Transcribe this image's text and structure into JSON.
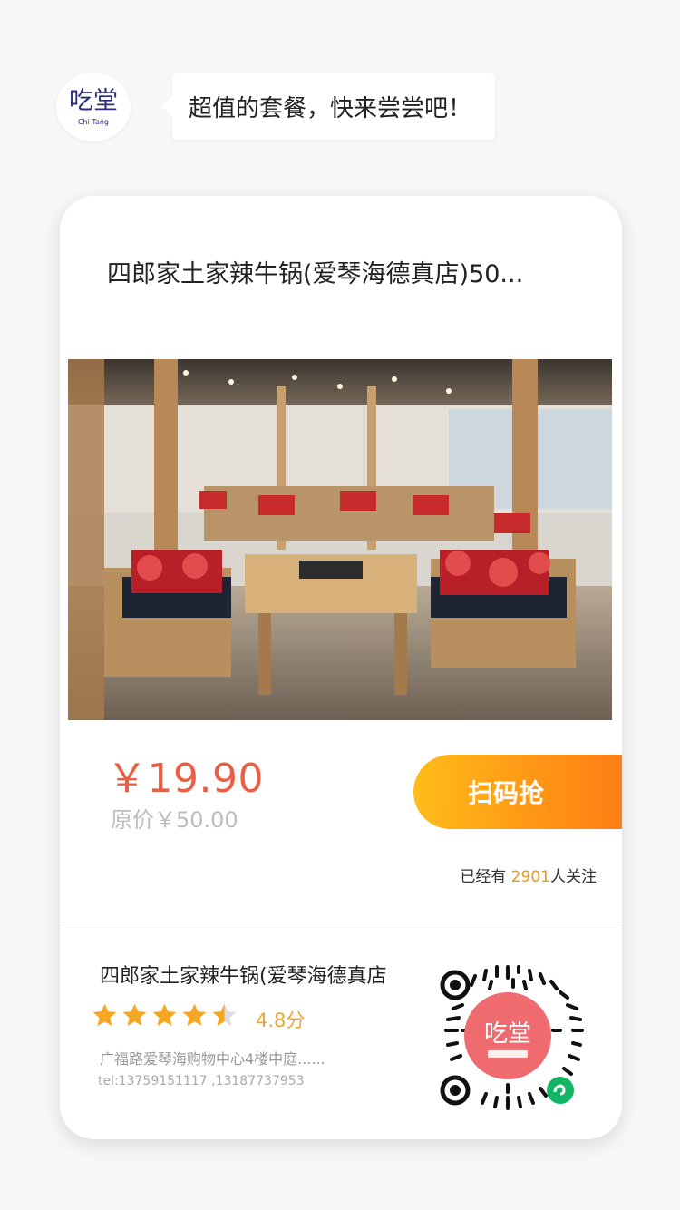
{
  "header": {
    "logo_text": "吃堂",
    "logo_sub": "Chi Tang",
    "message": "超值的套餐，快来尝尝吧！"
  },
  "card": {
    "title": "四郎家土家辣牛锅(爱琴海德真店)50...",
    "price": "￥19.90",
    "original_price": "原价￥50.00",
    "button_label": "扫码抢",
    "follow_prefix": "已经有",
    "follow_count": "2901",
    "follow_suffix": "人关注"
  },
  "shop": {
    "name": "四郎家土家辣牛锅(爱琴海德真店",
    "rating_stars": 4.5,
    "rating_text": "4.8分",
    "address": "广福路爱琴海购物中心4楼中庭......",
    "tel": "tel:13759151117 ,13187737953"
  },
  "qr": {
    "center_text": "吃堂"
  },
  "colors": {
    "price": "#e85f45",
    "button_start": "#ffbd1a",
    "button_end": "#ff7a14",
    "star": "#f5a623",
    "qr_center": "#ef6b70",
    "miniprogram_badge": "#12b564"
  }
}
